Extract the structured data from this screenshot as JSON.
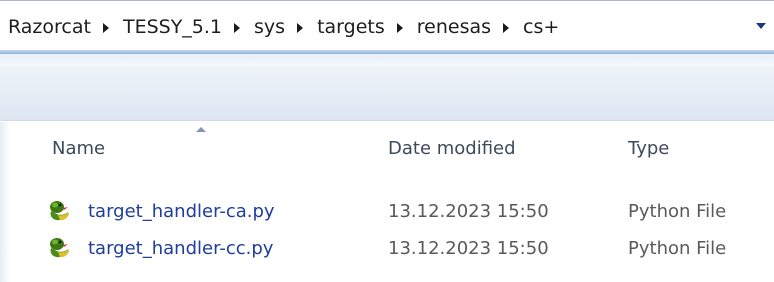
{
  "breadcrumb": {
    "items": [
      "Razorcat",
      "TESSY_5.1",
      "sys",
      "targets",
      "renesas",
      "cs+"
    ]
  },
  "columns": {
    "name": "Name",
    "date_modified": "Date modified",
    "type": "Type"
  },
  "files": [
    {
      "name": "target_handler-ca.py",
      "date_modified": "13.12.2023 15:50",
      "type": "Python File",
      "icon": "python-file-icon"
    },
    {
      "name": "target_handler-cc.py",
      "date_modified": "13.12.2023 15:50",
      "type": "Python File",
      "icon": "python-file-icon"
    }
  ],
  "colors": {
    "link_blue": "#1f3d9b",
    "python_green": "#3b7a12",
    "python_yellow": "#e2c02a"
  }
}
